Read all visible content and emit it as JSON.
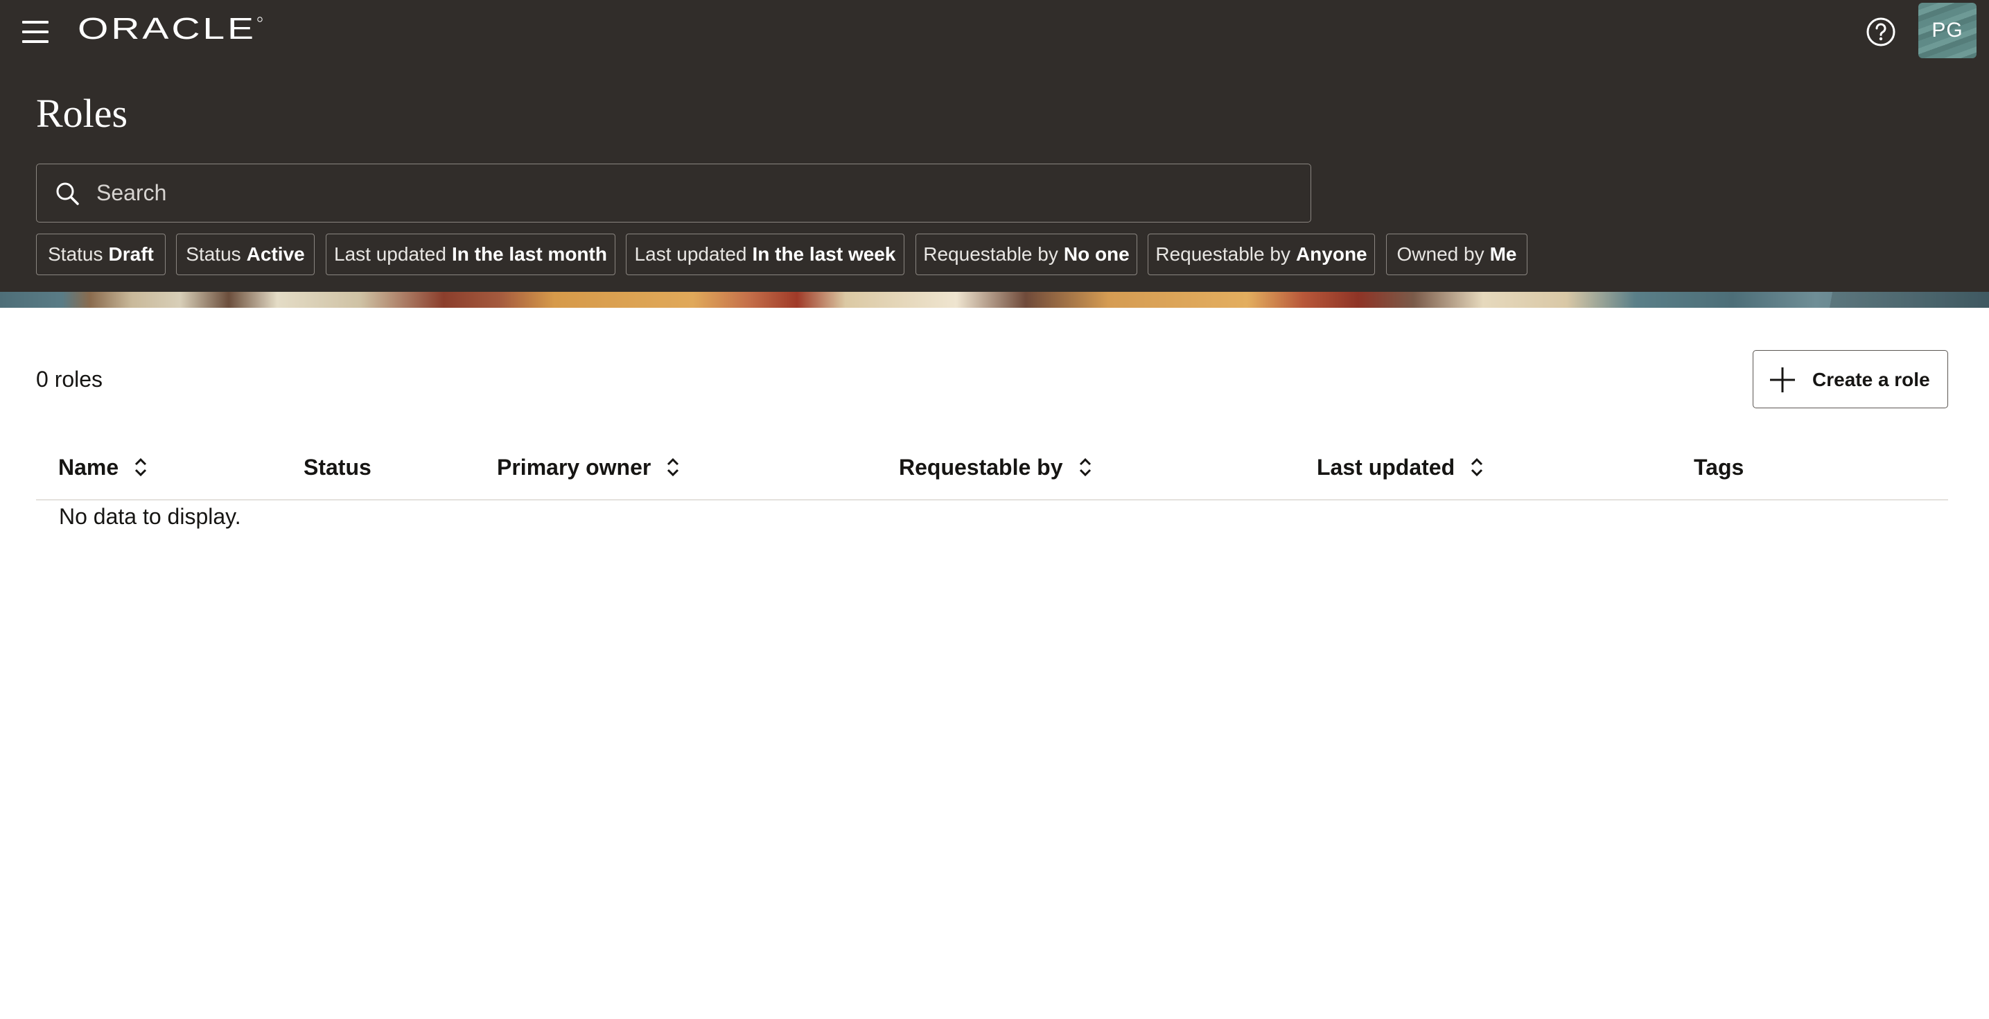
{
  "header": {
    "brand": "ORACLE",
    "avatar_initials": "PG",
    "icons": [
      "menu-icon",
      "help-icon"
    ]
  },
  "page": {
    "title": "Roles"
  },
  "search": {
    "placeholder": "Search",
    "value": ""
  },
  "filters": [
    {
      "key": "Status",
      "value": "Draft"
    },
    {
      "key": "Status",
      "value": "Active"
    },
    {
      "key": "Last updated",
      "value": "In the last month"
    },
    {
      "key": "Last updated",
      "value": "In the last week"
    },
    {
      "key": "Requestable by",
      "value": "No one"
    },
    {
      "key": "Requestable by",
      "value": "Anyone"
    },
    {
      "key": "Owned by",
      "value": "Me"
    }
  ],
  "content": {
    "count_label": "0 roles",
    "create_button": "Create a role"
  },
  "table": {
    "columns": [
      {
        "label": "Name",
        "sortable": true
      },
      {
        "label": "Status",
        "sortable": false
      },
      {
        "label": "Primary owner",
        "sortable": true
      },
      {
        "label": "Requestable by",
        "sortable": true
      },
      {
        "label": "Last updated",
        "sortable": true
      },
      {
        "label": "Tags",
        "sortable": false
      }
    ],
    "rows": [],
    "empty_message": "No data to display."
  },
  "colors": {
    "header_bg": "#312d2a",
    "text": "#161513",
    "avatar_bg": "#5f8a87"
  }
}
